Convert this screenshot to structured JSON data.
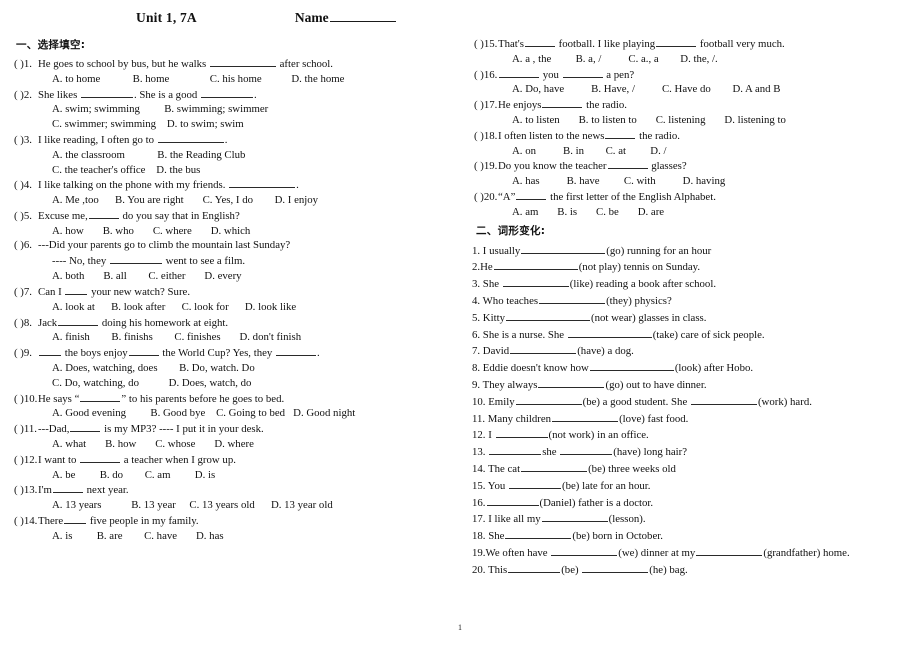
{
  "header": {
    "title": "Unit 1, 7A",
    "name_label": "Name"
  },
  "footer": {
    "page_number": "1"
  },
  "section_one": {
    "heading": "一、选择填空:",
    "questions": [
      {
        "marker": "(      )1.",
        "parts": [
          "He goes to school by bus, but he walks ",
          " after school."
        ],
        "options": [
          "A. to home",
          "B. home",
          "C. his home",
          "D. the home"
        ],
        "option_lines": 1
      },
      {
        "marker": "(      )2.",
        "parts": [
          "She likes ",
          ". She is a good ",
          "."
        ],
        "options": [
          "A. swim; swimming",
          "B. swimming; swimmer",
          "C. swimmer; swimming",
          "D. to swim; swim"
        ],
        "option_lines": 2
      },
      {
        "marker": "(      )3.",
        "parts": [
          " I like reading, I often go to ",
          "."
        ],
        "options": [
          "A. the classroom",
          "B. the Reading Club",
          "C. the teacher's office",
          "D. the bus"
        ],
        "option_lines": 2
      },
      {
        "marker": "(      )4.",
        "parts": [
          " I like talking on the phone with my friends.   ",
          "."
        ],
        "options": [
          "A. Me ,too",
          "B. You are right",
          "C. Yes, I do",
          "D. I enjoy"
        ],
        "option_lines": 1
      },
      {
        "marker": "(      )5.",
        "parts": [
          " Excuse me,",
          " do you say that in English?"
        ],
        "options": [
          "A. how",
          "B. who",
          "C. where",
          "D. which"
        ],
        "option_lines": 1
      },
      {
        "marker": "(      )6.",
        "parts": [
          " ---Did your parents go to climb the mountain last Sunday?"
        ],
        "sub_line_parts": [
          "---- No, they ",
          " went to see a film."
        ],
        "options": [
          "A. both",
          "B. all",
          "C. either",
          "D. every"
        ],
        "option_lines": 1
      },
      {
        "marker": "(      )7.",
        "parts": [
          " Can I ",
          " your new watch?      Sure."
        ],
        "options": [
          "A. look at",
          "B. look after",
          "C. look for",
          "D. look like"
        ],
        "option_lines": 1
      },
      {
        "marker": "(      )8.",
        "parts": [
          " Jack",
          " doing his homework at eight."
        ],
        "options": [
          "A. finish",
          "B. finishs",
          "C. finishes",
          "D. don't finish"
        ],
        "option_lines": 1
      },
      {
        "marker": "(      )9.",
        "parts": [
          " ",
          " the boys enjoy",
          " the World Cup?    Yes, they ",
          "."
        ],
        "options": [
          "A. Does, watching, does",
          "B. Do, watch. Do",
          "C. Do, watching, do",
          "D. Does, watch, do"
        ],
        "option_lines": 2
      },
      {
        "marker": "(      )10.",
        "parts": [
          " He says “",
          "” to his parents before he goes to bed."
        ],
        "options": [
          "A. Good evening",
          "B. Good bye",
          "C. Going to bed",
          "D. Good night"
        ],
        "option_lines": 1
      },
      {
        "marker": "(      )11.",
        "parts": [
          "---Dad,",
          " is my MP3?      ---- I put it in your desk."
        ],
        "options": [
          "A. what",
          "B. how",
          "C. whose",
          "D. where"
        ],
        "option_lines": 1
      },
      {
        "marker": "(      )12.",
        "parts": [
          " I want to ",
          " a teacher when I grow up."
        ],
        "options": [
          "A. be",
          "B. do",
          "C. am",
          "D. is"
        ],
        "option_lines": 1
      },
      {
        "marker": "(      )13.",
        "parts": [
          " I'm",
          " next year."
        ],
        "options": [
          "A. 13 years",
          "B. 13 year",
          "C. 13 years old",
          "D. 13 year old"
        ],
        "option_lines": 1
      },
      {
        "marker": "(      )14.",
        "parts": [
          " There",
          " five people in my family."
        ],
        "options": [
          "A. is",
          "B. are",
          "C. have",
          "D. has"
        ],
        "option_lines": 1
      },
      {
        "marker": "(      )15.",
        "parts": [
          " That's",
          " football. I like playing",
          " football very much."
        ],
        "options": [
          "A. a , the",
          "B. a,   /",
          "C. a., a",
          "D. the,   /."
        ],
        "option_lines": 1
      },
      {
        "marker": "(      )16.",
        "parts": [
          " ",
          " you ",
          "  a pen?"
        ],
        "options": [
          "A. Do, have",
          "B. Have,   /",
          "C. Have do",
          "D. A and B"
        ],
        "option_lines": 1
      },
      {
        "marker": "(      )17.",
        "parts": [
          " He enjoys",
          " the radio."
        ],
        "options": [
          "A. to listen",
          "B. to listen to",
          "C. listening",
          "D. listening to"
        ],
        "option_lines": 1
      },
      {
        "marker": "(      )18.",
        "parts": [
          " I often listen to the news",
          " the radio."
        ],
        "options": [
          "A. on",
          "B. in",
          "C. at",
          "D. /"
        ],
        "option_lines": 1
      },
      {
        "marker": "(      )19.",
        "parts": [
          " Do you know the teacher",
          " glasses?"
        ],
        "options": [
          "A. has",
          "B. have",
          "C. with",
          "D. having"
        ],
        "option_lines": 1
      },
      {
        "marker": "(      )20.",
        "parts": [
          " “A”",
          " the first letter of the English Alphabet."
        ],
        "options": [
          "A. am",
          "B. is",
          "C. be",
          "D. are"
        ],
        "option_lines": 1
      }
    ]
  },
  "section_two": {
    "heading": "二、词形变化:",
    "items": [
      {
        "number": "1.",
        "parts": [
          " I usually",
          "(go) running for an hour"
        ]
      },
      {
        "number": "2.",
        "parts": [
          "He",
          "(not play) tennis on Sunday."
        ]
      },
      {
        "number": "3.",
        "parts": [
          " She ",
          "(like) reading a book after school."
        ]
      },
      {
        "number": "4.",
        "parts": [
          " Who teaches",
          "(they) physics?"
        ]
      },
      {
        "number": "5.",
        "parts": [
          " Kitty",
          "(not wear) glasses in class."
        ]
      },
      {
        "number": "6.",
        "parts": [
          " She is a nurse. She ",
          "(take) care of sick people."
        ]
      },
      {
        "number": "7.",
        "parts": [
          " David",
          "(have) a dog."
        ]
      },
      {
        "number": "8.",
        "parts": [
          " Eddie doesn't know how",
          "(look) after Hobo."
        ]
      },
      {
        "number": "9.",
        "parts": [
          " They always",
          "(go) out to have dinner."
        ]
      },
      {
        "number": "10.",
        "parts": [
          " Emily",
          "(be) a good student. She ",
          "(work) hard."
        ]
      },
      {
        "number": "11.",
        "parts": [
          " Many children",
          "(love) fast food."
        ]
      },
      {
        "number": "12.",
        "parts": [
          " I ",
          "(not work) in an office."
        ]
      },
      {
        "number": "13.",
        "parts": [
          " ",
          "she ",
          "(have) long hair?"
        ]
      },
      {
        "number": "14.",
        "parts": [
          " The cat",
          "(be) three weeks old"
        ]
      },
      {
        "number": "15.",
        "parts": [
          " You ",
          "(be) late for an hour."
        ]
      },
      {
        "number": "16.",
        "parts": [
          "",
          "(Daniel) father is a doctor."
        ]
      },
      {
        "number": "17.",
        "parts": [
          " I like all my",
          "(lesson)."
        ]
      },
      {
        "number": "18.",
        "parts": [
          " She",
          "(be) born in October."
        ]
      },
      {
        "number": "19.",
        "parts": [
          "We often have ",
          "(we) dinner at my",
          "(grandfather) home."
        ]
      },
      {
        "number": "20.",
        "parts": [
          " This",
          "(be) ",
          "(he) bag."
        ]
      }
    ]
  }
}
